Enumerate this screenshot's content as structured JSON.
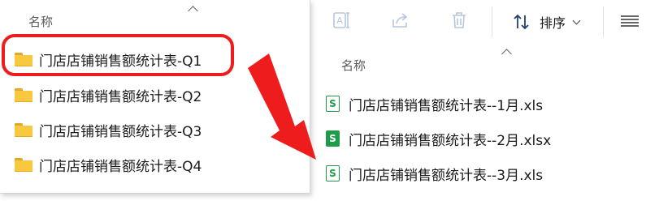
{
  "left_pane": {
    "column_header": "名称",
    "folders": [
      {
        "name": "门店店铺销售额统计表-Q1",
        "icon": "folder-icon"
      },
      {
        "name": "门店店铺销售额统计表-Q2",
        "icon": "folder-icon"
      },
      {
        "name": "门店店铺销售额统计表-Q3",
        "icon": "folder-icon"
      },
      {
        "name": "门店店铺销售额统计表-Q4",
        "icon": "folder-icon"
      }
    ]
  },
  "toolbar": {
    "rename_icon": "rename-icon",
    "share_icon": "share-icon",
    "delete_icon": "trash-icon",
    "sort_label": "排序",
    "sort_icon": "sort-icon",
    "view_icon": "view-list-icon"
  },
  "right_pane": {
    "column_header": "名称",
    "files": [
      {
        "name": "门店店铺销售额统计表--1月.xls",
        "icon_letter": "S",
        "style": "outline"
      },
      {
        "name": "门店店铺销售额统计表--2月.xlsx",
        "icon_letter": "S",
        "style": "filled"
      },
      {
        "name": "门店店铺销售额统计表--3月.xls",
        "icon_letter": "S",
        "style": "outline"
      }
    ]
  },
  "colors": {
    "highlight": "#ee1c1c",
    "arrow": "#ee1c1c",
    "folder": "#f8c93f",
    "excel_green": "#1f9c4a"
  }
}
